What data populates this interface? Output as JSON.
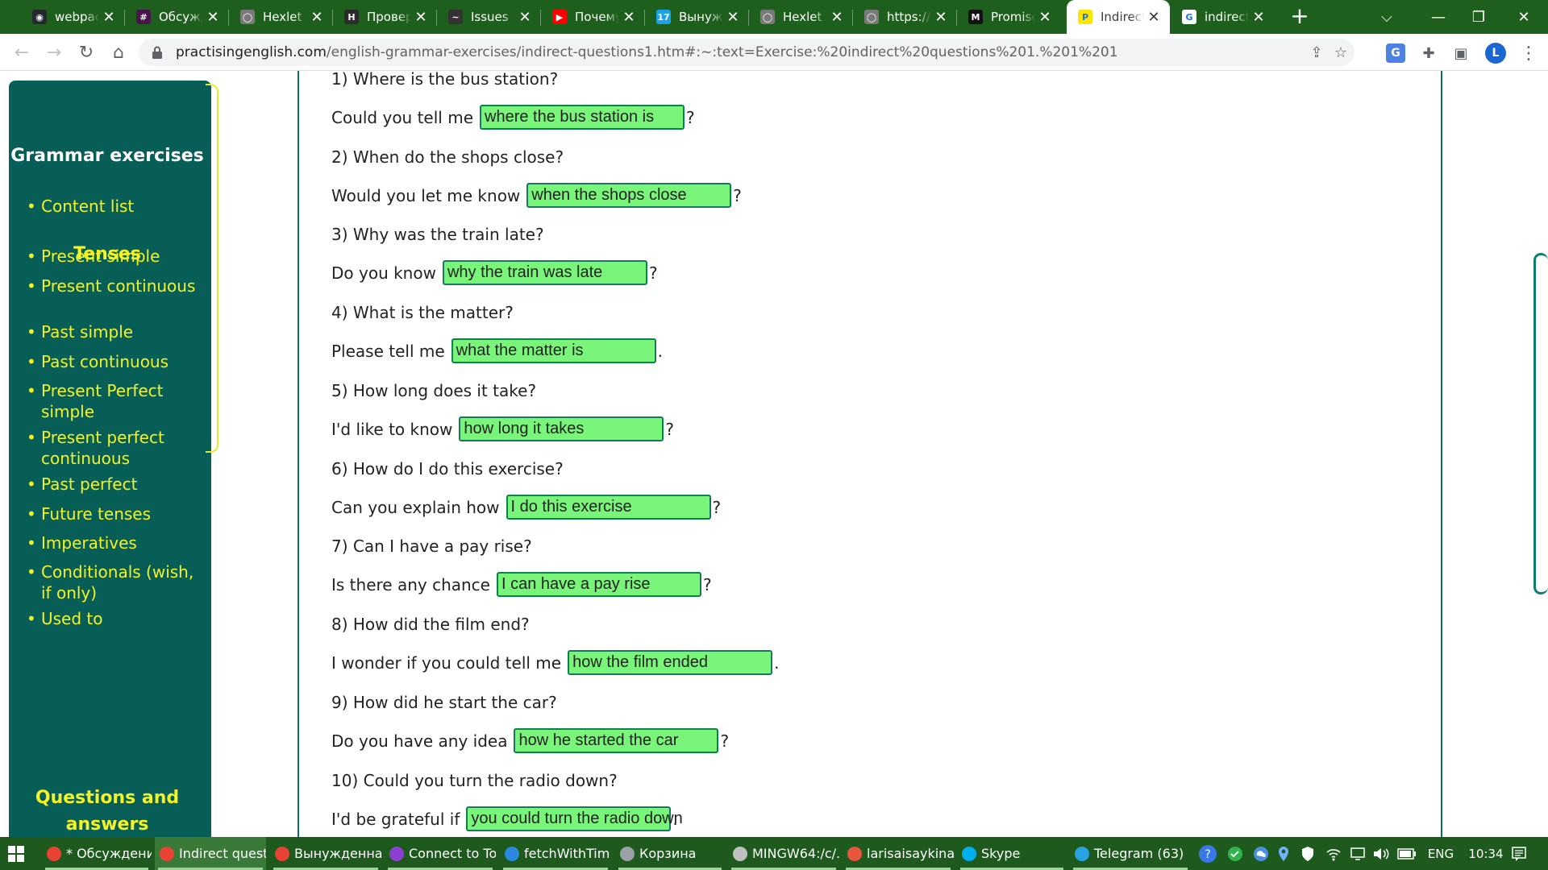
{
  "browser": {
    "tabs": [
      {
        "title": "webpack",
        "color": "#24292f",
        "glyph": "◉",
        "active": false
      },
      {
        "title": "Обсуждение",
        "color": "#4a154b",
        "glyph": "#",
        "active": false
      },
      {
        "title": "Hexlet Projects",
        "color": "#7a7a7a",
        "glyph": "◯",
        "active": false
      },
      {
        "title": "Проверка",
        "color": "#2b2b2b",
        "glyph": "H",
        "active": false
      },
      {
        "title": "Issues",
        "color": "#333333",
        "glyph": "~",
        "active": false
      },
      {
        "title": "Почему",
        "color": "#ff0000",
        "glyph": "▶",
        "active": false
      },
      {
        "title": "Вынужденная",
        "color": "#1aa3e8",
        "glyph": "17",
        "active": false
      },
      {
        "title": "Hexlet Projects",
        "color": "#7a7a7a",
        "glyph": "◯",
        "active": false
      },
      {
        "title": "https://",
        "color": "#7a7a7a",
        "glyph": "◯",
        "active": false
      },
      {
        "title": "Promise",
        "color": "#111111",
        "glyph": "M",
        "active": false
      },
      {
        "title": "Indirect",
        "color": "#ffe600",
        "glyph": "P",
        "active": true
      },
      {
        "title": "indirect",
        "color": "#ffffff",
        "glyph": "G",
        "active": false
      }
    ],
    "close_glyph": "✕",
    "new_tab_glyph": "+",
    "window_controls": {
      "dropdown": "⌵",
      "minimize": "—",
      "restore": "❐",
      "close": "✕"
    },
    "nav": {
      "back": "←",
      "forward": "→",
      "reload": "↻",
      "home": "⌂"
    },
    "url_host": "practisingenglish.com",
    "url_path": "/english-grammar-exercises/indirect-questions1.htm#:~:text=Exercise:%20indirect%20questions%201.%201%201",
    "profile_initial": "L",
    "icons": {
      "share": "⇪",
      "bookmark": "☆",
      "translate": "G",
      "extensions": "✚",
      "sidepanel": "▣",
      "menu": "⋮"
    }
  },
  "sidebar": {
    "title": "Grammar exercises",
    "content_link": "Content list",
    "tenses_heading": "Tenses",
    "items": [
      "Present simple",
      "Present continuous",
      "Past simple",
      "Past continuous",
      "Present Perfect simple",
      "Present perfect continuous",
      "Past perfect",
      "Future tenses",
      "Imperatives",
      "Conditionals (wish, if only)",
      "Used to"
    ],
    "qa_heading": "Questions and answers"
  },
  "exercise": {
    "items": [
      {
        "question": "1) Where is the bus station?",
        "prefix": "Could you tell me",
        "answer": "where the bus station is",
        "end": "?"
      },
      {
        "question": "2) When do the shops close?",
        "prefix": "Would you let me know",
        "answer": "when the shops close",
        "end": "?"
      },
      {
        "question": "3) Why was the train late?",
        "prefix": "Do you know",
        "answer": "why the train was late",
        "end": "?"
      },
      {
        "question": "4) What is the matter?",
        "prefix": "Please tell me",
        "answer": "what the matter is",
        "end": "."
      },
      {
        "question": "5) How long does it take?",
        "prefix": "I'd like to know",
        "answer": "how long it takes",
        "end": "?"
      },
      {
        "question": "6) How do I do this exercise?",
        "prefix": "Can you explain how",
        "answer": "I do this exercise",
        "end": "?"
      },
      {
        "question": "7) Can I have a pay rise?",
        "prefix": "Is there any chance",
        "answer": "I can have a pay rise",
        "end": "?"
      },
      {
        "question": "8) How did the film end?",
        "prefix": "I wonder if you could tell me",
        "answer": "how the film ended",
        "end": "."
      },
      {
        "question": "9) How did he start the car?",
        "prefix": "Do you have any idea",
        "answer": "how he started the car",
        "end": "?"
      },
      {
        "question": "10) Could you turn the radio down?",
        "prefix": "I'd be grateful if",
        "answer": "you could turn the radio down",
        "end": "."
      }
    ]
  },
  "taskbar": {
    "apps": [
      {
        "label": "* Обсуждени...",
        "color": "#e94235"
      },
      {
        "label": "Indirect quest...",
        "color": "#e94235"
      },
      {
        "label": "Вынужденна...",
        "color": "#e94235"
      },
      {
        "label": "Connect to To...",
        "color": "#8a3fd1"
      },
      {
        "label": "fetchWithTim...",
        "color": "#2b8ae0"
      },
      {
        "label": "Корзина",
        "color": "#9aa0a6"
      },
      {
        "label": "MINGW64:/c/...",
        "color": "#c0c0c0"
      },
      {
        "label": "larisaisaykina...",
        "color": "#e8553d"
      },
      {
        "label": "Skype",
        "color": "#00aff0"
      },
      {
        "label": "Telegram (63)",
        "color": "#2aa3e3"
      }
    ],
    "language": "ENG",
    "time": "10:34"
  }
}
